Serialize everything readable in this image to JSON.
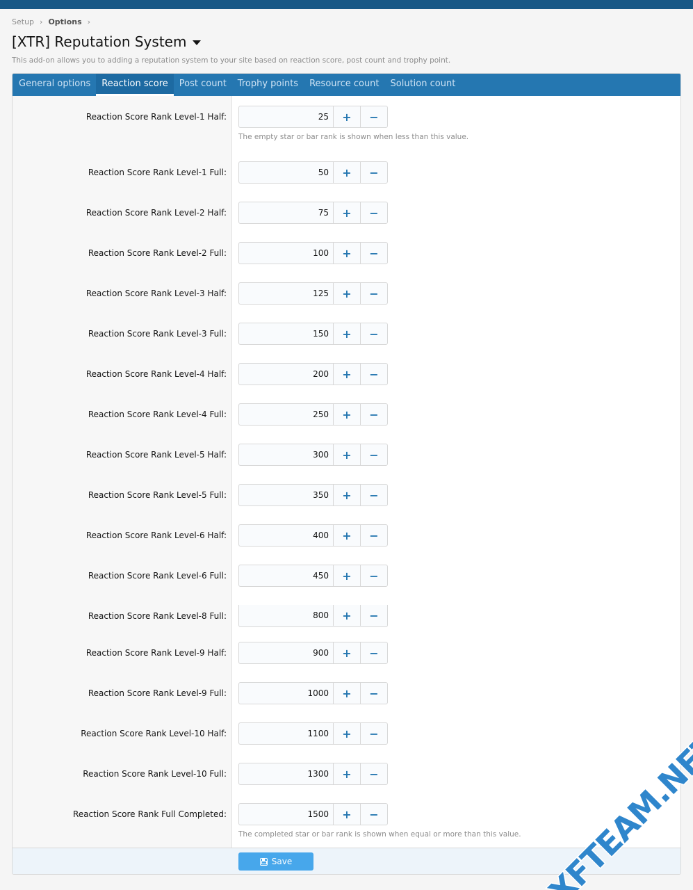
{
  "breadcrumb": [
    "Setup",
    "Options"
  ],
  "page": {
    "title": "[XTR] Reputation System",
    "description": "This add-on allows you to adding a reputation system to your site based on reaction score, post count and trophy point."
  },
  "tabs": [
    {
      "label": "General options"
    },
    {
      "label": "Reaction score"
    },
    {
      "label": "Post count"
    },
    {
      "label": "Trophy points"
    },
    {
      "label": "Resource count"
    },
    {
      "label": "Solution count"
    }
  ],
  "active_tab": "Reaction score",
  "fields": [
    {
      "label": "Reaction Score Rank Level-1 Half:",
      "value": "25",
      "hint": "The empty star or bar rank is shown when less than this value."
    },
    {
      "label": "Reaction Score Rank Level-1 Full:",
      "value": "50"
    },
    {
      "label": "Reaction Score Rank Level-2 Half:",
      "value": "75"
    },
    {
      "label": "Reaction Score Rank Level-2 Full:",
      "value": "100"
    },
    {
      "label": "Reaction Score Rank Level-3 Half:",
      "value": "125"
    },
    {
      "label": "Reaction Score Rank Level-3 Full:",
      "value": "150"
    },
    {
      "label": "Reaction Score Rank Level-4 Half:",
      "value": "200"
    },
    {
      "label": "Reaction Score Rank Level-4 Full:",
      "value": "250"
    },
    {
      "label": "Reaction Score Rank Level-5 Half:",
      "value": "300"
    },
    {
      "label": "Reaction Score Rank Level-5 Full:",
      "value": "350"
    },
    {
      "label": "Reaction Score Rank Level-6 Half:",
      "value": "400"
    },
    {
      "label": "Reaction Score Rank Level-6 Full:",
      "value": "450"
    },
    {
      "label": "Reaction Score Rank Level-8 Full:",
      "value": "800"
    },
    {
      "label": "Reaction Score Rank Level-9 Half:",
      "value": "900"
    },
    {
      "label": "Reaction Score Rank Level-9 Full:",
      "value": "1000"
    },
    {
      "label": "Reaction Score Rank Level-10 Half:",
      "value": "1100"
    },
    {
      "label": "Reaction Score Rank Level-10 Full:",
      "value": "1300"
    },
    {
      "label": "Reaction Score Rank Full Completed:",
      "value": "1500",
      "hint": "The completed star or bar rank is shown when equal or more than this value."
    }
  ],
  "stepper": {
    "plus": "+",
    "minus": "−"
  },
  "footer": {
    "save_label": "Save"
  },
  "watermark": "XFTEAM.NET",
  "colors": {
    "header": "#185886",
    "tabs": "#2577b1",
    "accent": "#47a7eb"
  }
}
